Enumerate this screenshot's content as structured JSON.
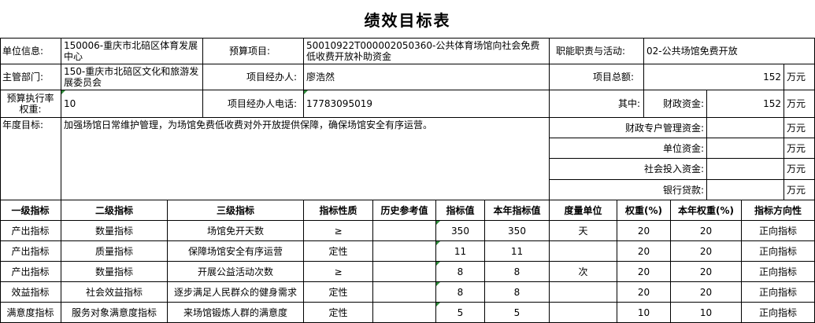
{
  "title": "绩效目标表",
  "info": {
    "unit_label": "单位信息:",
    "unit_value": "150006-重庆市北碚区体育发展中心",
    "budget_project_label": "预算项目:",
    "budget_project_value": "50010922T000002050360-公共体育场馆向社会免费低收费开放补助资金",
    "duty_label": "职能职责与活动:",
    "duty_value": "02-公共场馆免费开放",
    "dept_label": "主管部门:",
    "dept_value": "150-重庆市北碚区文化和旅游发展委员会",
    "manager_label": "项目经办人:",
    "manager_value": "廖浩然",
    "total_label": "项目总额:",
    "total_value": "152",
    "exec_weight_label": "预算执行率权重:",
    "exec_weight_value": "10",
    "phone_label": "项目经办人电话:",
    "phone_value": "17783095019",
    "among_label": "其中:",
    "fiscal_label": "财政资金:",
    "fiscal_value": "152",
    "special_label": "财政专户管理资金:",
    "special_value": "",
    "unitfund_label": "单位资金:",
    "unitfund_value": "",
    "social_label": "社会投入资金:",
    "social_value": "",
    "loan_label": "银行贷款:",
    "loan_value": "",
    "unit_wanyuan": "万元",
    "annual_goal_label": "年度目标:",
    "annual_goal_value": "加强场馆日常维护管理，为场馆免费低收费对外开放提供保障，确保场馆安全有序运营。"
  },
  "indicator_headers": [
    "一级指标",
    "二级指标",
    "三级指标",
    "指标性质",
    "历史参考值",
    "指标值",
    "本年指标值",
    "度量单位",
    "权重(%)",
    "本年权重(%)",
    "指标方向性"
  ],
  "indicator_rows": [
    [
      "产出指标",
      "数量指标",
      "场馆免开天数",
      "≥",
      "",
      "350",
      "350",
      "天",
      "20",
      "20",
      "正向指标"
    ],
    [
      "产出指标",
      "质量指标",
      "保障场馆安全有序运营",
      "定性",
      "",
      "11",
      "11",
      "",
      "20",
      "20",
      "正向指标"
    ],
    [
      "产出指标",
      "数量指标",
      "开展公益活动次数",
      "≥",
      "",
      "8",
      "8",
      "次",
      "20",
      "20",
      "正向指标"
    ],
    [
      "效益指标",
      "社会效益指标",
      "逐步满足人民群众的健身需求",
      "定性",
      "",
      "8",
      "8",
      "",
      "20",
      "20",
      "正向指标"
    ],
    [
      "满意度指标",
      "服务对象满意度指标",
      "来场馆锻炼人群的满意度",
      "定性",
      "",
      "5",
      "5",
      "",
      "10",
      "10",
      "正向指标"
    ]
  ]
}
